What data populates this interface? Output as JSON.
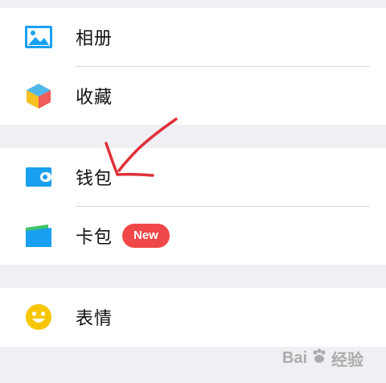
{
  "menu": {
    "album": {
      "label": "相册",
      "icon": "album-icon"
    },
    "favorites": {
      "label": "收藏",
      "icon": "favorites-cube-icon"
    },
    "wallet": {
      "label": "钱包",
      "icon": "wallet-icon"
    },
    "cards": {
      "label": "卡包",
      "icon": "card-wallet-icon",
      "badge": "New"
    },
    "stickers": {
      "label": "表情",
      "icon": "smiley-icon"
    }
  },
  "colors": {
    "page_background": "#efeff4",
    "row_background": "#ffffff",
    "divider": "#d9d9d9",
    "badge": "#f04848",
    "annotation_arrow": "#e0303a",
    "album_icon": "#1aa0f0",
    "wallet_icon": "#1aa0f0",
    "smiley_icon": "#f7c600"
  },
  "watermark": {
    "logo_text": "Bai",
    "logo_suffix": "经验",
    "icon": "baidu-paw-icon"
  }
}
